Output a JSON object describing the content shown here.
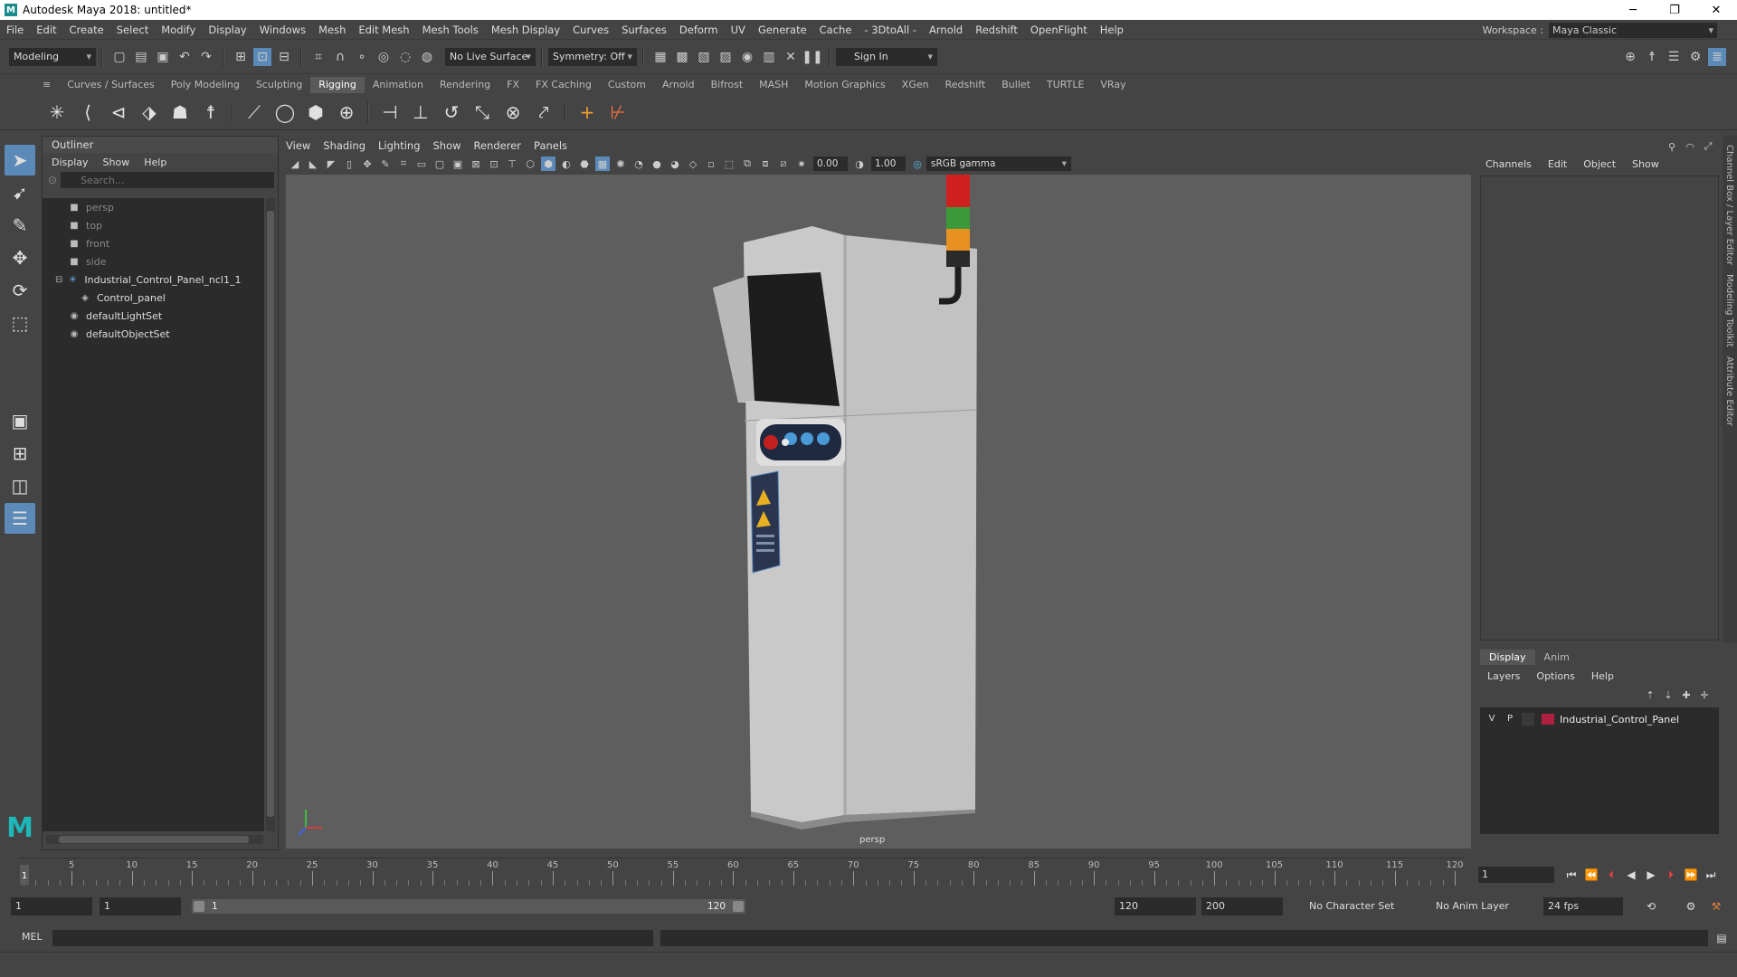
{
  "window": {
    "title": "Autodesk Maya 2018: untitled*",
    "logo_letter": "M",
    "controls": {
      "minimize": "─",
      "maximize": "❐",
      "close": "✕"
    }
  },
  "menubar": {
    "items": [
      "File",
      "Edit",
      "Create",
      "Select",
      "Modify",
      "Display",
      "Windows",
      "Mesh",
      "Edit Mesh",
      "Mesh Tools",
      "Mesh Display",
      "Curves",
      "Surfaces",
      "Deform",
      "UV",
      "Generate",
      "Cache",
      "- 3DtoAll -",
      "Arnold",
      "Redshift",
      "OpenFlight",
      "Help"
    ],
    "workspace_label": "Workspace :",
    "workspace_value": "Maya Classic"
  },
  "statusline": {
    "mode": "Modeling",
    "live_surface": "No Live Surface",
    "symmetry": "Symmetry: Off",
    "sign_in": "Sign In"
  },
  "shelf": {
    "tabs": [
      "Curves / Surfaces",
      "Poly Modeling",
      "Sculpting",
      "Rigging",
      "Animation",
      "Rendering",
      "FX",
      "FX Caching",
      "Custom",
      "Arnold",
      "Bifrost",
      "MASH",
      "Motion Graphics",
      "XGen",
      "Redshift",
      "Bullet",
      "TURTLE",
      "VRay"
    ],
    "active_tab": "Rigging"
  },
  "outliner": {
    "title": "Outliner",
    "menu": [
      "Display",
      "Show",
      "Help"
    ],
    "search_placeholder": "Search...",
    "items": [
      {
        "label": "persp",
        "icon": "camera-icon",
        "dim": true,
        "indent": 0
      },
      {
        "label": "top",
        "icon": "camera-icon",
        "dim": true,
        "indent": 0
      },
      {
        "label": "front",
        "icon": "camera-icon",
        "dim": true,
        "indent": 0
      },
      {
        "label": "side",
        "icon": "camera-icon",
        "dim": true,
        "indent": 0
      },
      {
        "label": "Industrial_Control_Panel_ncl1_1",
        "icon": "joint-icon",
        "dim": false,
        "indent": 0,
        "expander": "⊟"
      },
      {
        "label": "Control_panel",
        "icon": "mesh-icon",
        "dim": false,
        "indent": 1
      },
      {
        "label": "defaultLightSet",
        "icon": "set-icon",
        "dim": false,
        "indent": 0
      },
      {
        "label": "defaultObjectSet",
        "icon": "set-icon",
        "dim": false,
        "indent": 0
      }
    ]
  },
  "viewport": {
    "menu": [
      "View",
      "Shading",
      "Lighting",
      "Show",
      "Renderer",
      "Panels"
    ],
    "exposure": "0.00",
    "gamma": "1.00",
    "color_space": "sRGB gamma",
    "camera_label": "persp"
  },
  "channelbox": {
    "menu": [
      "Channels",
      "Edit",
      "Object",
      "Show"
    ],
    "side_tabs": [
      "Channel Box / Layer Editor",
      "Modeling Toolkit",
      "Attribute Editor"
    ]
  },
  "layer_editor": {
    "tabs": [
      "Display",
      "Anim"
    ],
    "active_tab": "Display",
    "menu": [
      "Layers",
      "Options",
      "Help"
    ],
    "layers": [
      {
        "v": "V",
        "p": "P",
        "name": "Industrial_Control_Panel",
        "color": "#b02040"
      }
    ]
  },
  "timeslider": {
    "ticks": [
      1,
      5,
      10,
      15,
      20,
      25,
      30,
      35,
      40,
      45,
      50,
      55,
      60,
      65,
      70,
      75,
      80,
      85,
      90,
      95,
      100,
      105,
      110,
      115,
      120
    ],
    "current_frame": "1",
    "current_frame_field": "1"
  },
  "range": {
    "start_time": "1",
    "playback_start": "1",
    "range_start_label": "1",
    "range_end_label": "120",
    "playback_end": "120",
    "end_time": "200",
    "character_set": "No Character Set",
    "anim_layer": "No Anim Layer",
    "fps": "24 fps"
  },
  "cmdline": {
    "lang": "MEL"
  }
}
